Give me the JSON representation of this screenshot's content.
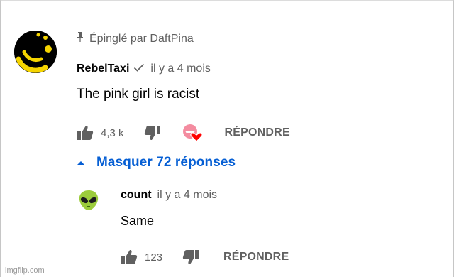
{
  "comment": {
    "pinned_text": "Épinglé par DaftPina",
    "author": "RebelTaxi",
    "timestamp": "il y a 4 mois",
    "text": "The pink girl is racist",
    "like_count": "4,3 k",
    "reply_label": "RÉPONDRE"
  },
  "replies_toggle": {
    "label": "Masquer 72 réponses"
  },
  "reply": {
    "author": "count",
    "timestamp": "il y a 4 mois",
    "text": "Same",
    "like_count": "123",
    "reply_label": "RÉPONDRE"
  },
  "watermark": "imgflip.com",
  "icons": {
    "pin": "pin-icon",
    "verified": "checkmark-icon",
    "like": "thumbs-up-icon",
    "dislike": "thumbs-down-icon",
    "heart": "creator-heart-icon",
    "toggle": "triangle-up-icon"
  },
  "colors": {
    "link_blue": "#065fd4",
    "secondary_text": "#606060",
    "heart_red": "#ff0000",
    "avatar_yellow": "#f5d400",
    "alien_green": "#9ccc3c"
  }
}
